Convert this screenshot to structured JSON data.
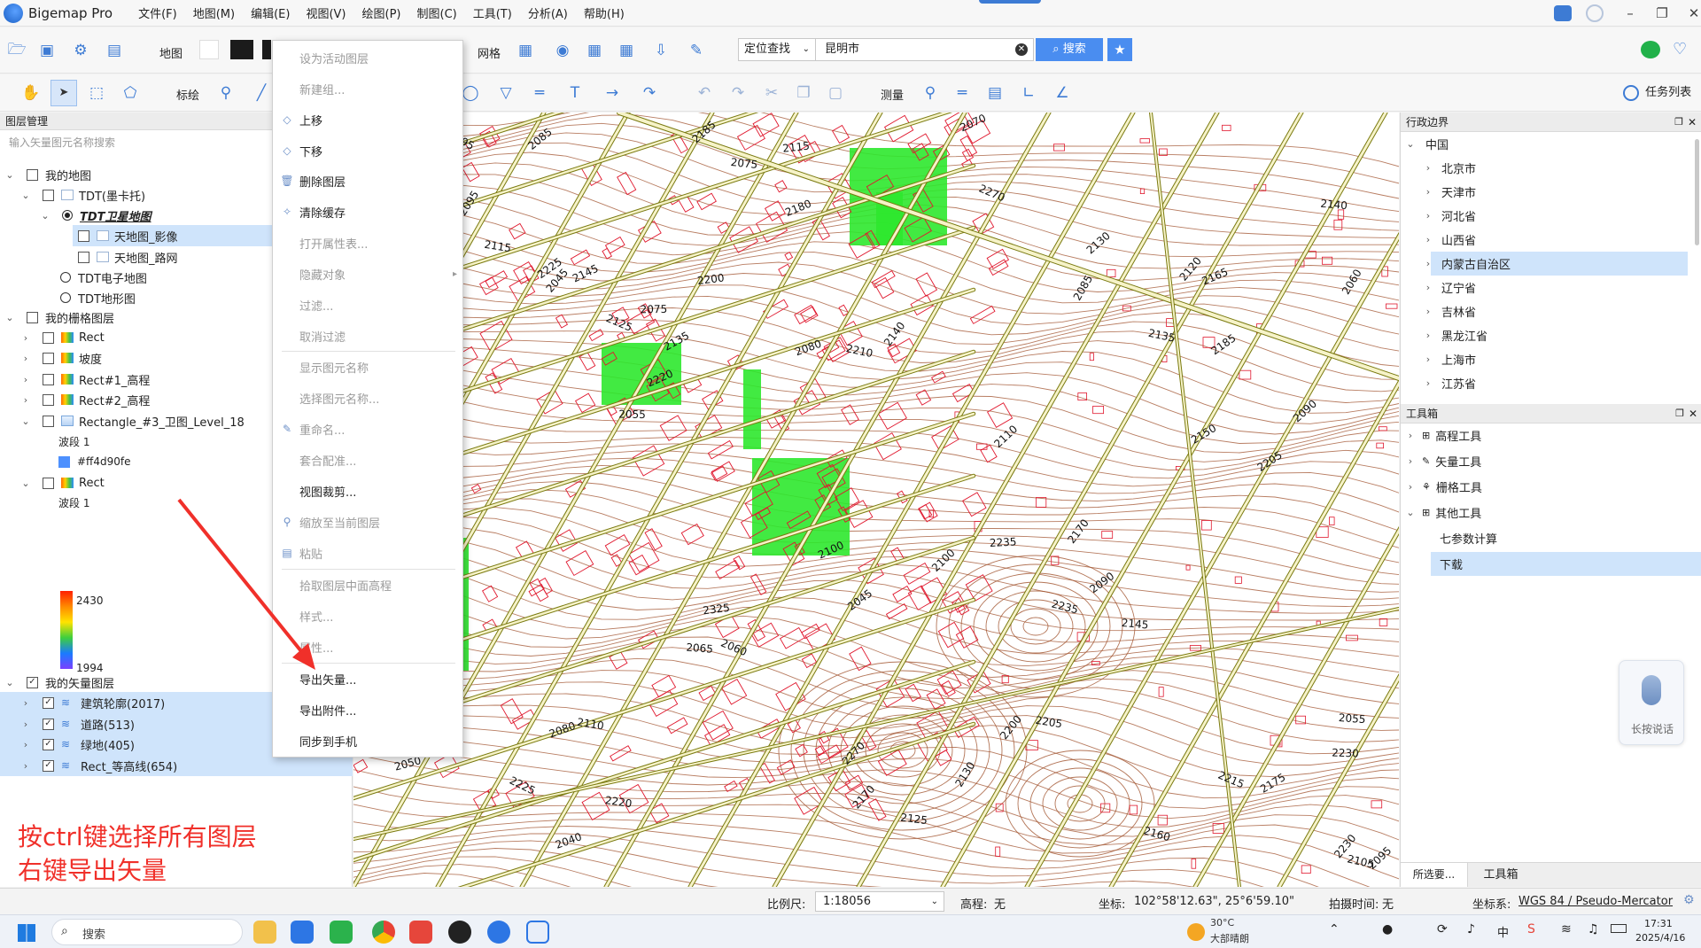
{
  "window": {
    "title": "Bigemap Pro"
  },
  "menu": [
    "文件(F)",
    "地图(M)",
    "编辑(E)",
    "视图(V)",
    "绘图(P)",
    "制图(C)",
    "工具(T)",
    "分析(A)",
    "帮助(H)"
  ],
  "toolbar1": {
    "map_label": "地图",
    "grid_label": "网格",
    "search_mode": "定位查找",
    "search_value": "昆明市",
    "search_button": "搜索"
  },
  "toolbar2": {
    "draw_label": "标绘",
    "measure_label": "测量",
    "task_list": "任务列表"
  },
  "layer_panel": {
    "title": "图层管理",
    "search_placeholder": "输入矢量图元名称搜索",
    "rows": [
      {
        "label": "我的地图"
      },
      {
        "label": "TDT(墨卡托)"
      },
      {
        "label": "TDT卫星地图"
      },
      {
        "label": "天地图_影像"
      },
      {
        "label": "天地图_路网"
      },
      {
        "label": "TDT电子地图"
      },
      {
        "label": "TDT地形图"
      },
      {
        "label": "我的栅格图层"
      },
      {
        "label": "Rect"
      },
      {
        "label": "坡度"
      },
      {
        "label": "Rect#1_高程"
      },
      {
        "label": "Rect#2_高程"
      },
      {
        "label": "Rectangle_#3_卫图_Level_18"
      },
      {
        "label": "波段 1"
      },
      {
        "label": "#ff4d90fe"
      },
      {
        "label": "Rect"
      },
      {
        "label": "波段 1"
      },
      {
        "label": "我的矢量图层"
      },
      {
        "label": "建筑轮廓(2017)"
      },
      {
        "label": "道路(513)"
      },
      {
        "label": "绿地(405)"
      },
      {
        "label": "Rect_等高线(654)"
      }
    ],
    "legend_max": "2430",
    "legend_min": "1994",
    "swatch_color": "#4d90fe"
  },
  "annotation": {
    "line1": "按ctrl键选择所有图层",
    "line2": "右键导出矢量",
    "color": "#f0302a"
  },
  "context_menu": [
    {
      "label": "设为活动图层",
      "disabled": true
    },
    {
      "label": "新建组...",
      "disabled": true
    },
    {
      "label": "上移",
      "disabled": false
    },
    {
      "label": "下移",
      "disabled": false
    },
    {
      "label": "删除图层",
      "disabled": false
    },
    {
      "label": "清除缓存",
      "disabled": false
    },
    {
      "label": "打开属性表...",
      "disabled": true
    },
    {
      "label": "隐藏对象",
      "disabled": true
    },
    {
      "label": "过滤...",
      "disabled": true
    },
    {
      "label": "取消过滤",
      "disabled": true
    },
    {
      "label": "显示图元名称",
      "disabled": true
    },
    {
      "label": "选择图元名称...",
      "disabled": true
    },
    {
      "label": "重命名...",
      "disabled": true
    },
    {
      "label": "套合配准...",
      "disabled": true
    },
    {
      "label": "视图裁剪...",
      "disabled": false
    },
    {
      "label": "缩放至当前图层",
      "disabled": true
    },
    {
      "label": "粘贴",
      "disabled": true
    },
    {
      "label": "拾取图层中面高程",
      "disabled": true
    },
    {
      "label": "样式...",
      "disabled": true
    },
    {
      "label": "属性...",
      "disabled": true
    },
    {
      "label": "导出矢量...",
      "disabled": false
    },
    {
      "label": "导出附件...",
      "disabled": false
    },
    {
      "label": "同步到手机",
      "disabled": false
    }
  ],
  "map": {
    "contour_labels": [
      "2045",
      "2060",
      "2050",
      "2065",
      "2070",
      "2080",
      "2085",
      "2055",
      "2090",
      "2075",
      "2095",
      "2100",
      "2110",
      "2115",
      "2125",
      "2130",
      "2145",
      "2165",
      "2170",
      "2185",
      "2200",
      "2205",
      "2210",
      "2220",
      "2225",
      "2230",
      "2235",
      "2270",
      "2135",
      "2140",
      "2150",
      "2160",
      "2175",
      "2180",
      "2195",
      "2215",
      "2325",
      "2120",
      "2105",
      "2040"
    ]
  },
  "admin_panel": {
    "title": "行政边界",
    "root": "中国",
    "items": [
      "北京市",
      "天津市",
      "河北省",
      "山西省",
      "内蒙古自治区",
      "辽宁省",
      "吉林省",
      "黑龙江省",
      "上海市",
      "江苏省"
    ],
    "selected": "内蒙古自治区"
  },
  "toolbox_panel": {
    "title": "工具箱",
    "items": [
      "高程工具",
      "矢量工具",
      "栅格工具",
      "其他工具"
    ],
    "sub_items": [
      "七参数计算",
      "下载"
    ],
    "selected": "下载"
  },
  "voice_widget": {
    "label": "长按说话"
  },
  "bottom_tabs": [
    "所选要...",
    "工具箱"
  ],
  "statusbar": {
    "scale_label": "比例尺:",
    "scale_value": "1:18056",
    "elev_label": "高程:",
    "elev_value": "无",
    "coord_label": "坐标:",
    "coord_value": "102°58'12.63\", 25°6'59.10\"",
    "shot_label": "拍摄时间:",
    "shot_value": "无",
    "crs_label": "坐标系:",
    "crs_value": "WGS 84 / Pseudo-Mercator"
  },
  "taskbar": {
    "search": "搜索",
    "weather_temp": "30°C",
    "weather_desc": "大部晴朗",
    "time": "17:31",
    "date": "2025/4/16",
    "ime": "中"
  }
}
